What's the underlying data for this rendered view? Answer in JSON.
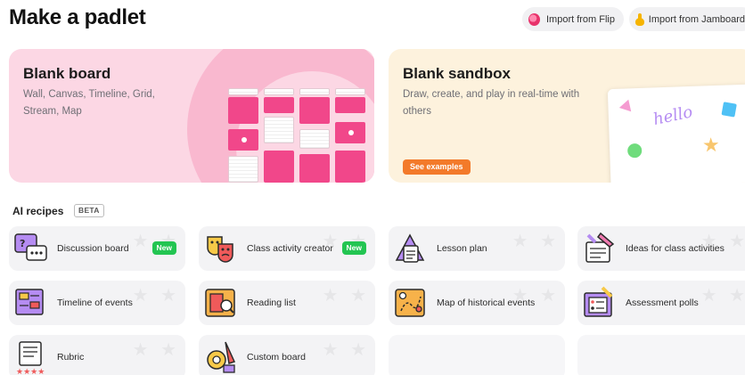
{
  "header": {
    "title": "Make a padlet",
    "import_flip": "Import from Flip",
    "import_jamboard": "Import from Jamboard"
  },
  "hero_board": {
    "title": "Blank board",
    "description": "Wall, Canvas, Timeline, Grid, Stream, Map"
  },
  "hero_sandbox": {
    "title": "Blank sandbox",
    "description": "Draw, create, and play in real-time with others",
    "button": "See examples",
    "doodle_text": "hello"
  },
  "ai_recipes": {
    "label": "AI recipes",
    "badge": "BETA",
    "new_badge": "New",
    "items": [
      {
        "label": "Discussion board",
        "icon": "discussion-icon",
        "is_new": true
      },
      {
        "label": "Class activity creator",
        "icon": "theater-masks-icon",
        "is_new": true
      },
      {
        "label": "Lesson plan",
        "icon": "lesson-plan-icon",
        "is_new": false
      },
      {
        "label": "Ideas for class activities",
        "icon": "ideas-icon",
        "is_new": false
      },
      {
        "label": "Timeline of events",
        "icon": "timeline-icon",
        "is_new": false
      },
      {
        "label": "Reading list",
        "icon": "reading-list-icon",
        "is_new": false
      },
      {
        "label": "Map of historical events",
        "icon": "map-icon",
        "is_new": false
      },
      {
        "label": "Assessment polls",
        "icon": "poll-icon",
        "is_new": false
      },
      {
        "label": "Rubric",
        "icon": "rubric-icon",
        "is_new": false
      },
      {
        "label": "Custom board",
        "icon": "custom-board-icon",
        "is_new": false
      }
    ]
  },
  "colors": {
    "board_bg": "#fcd7e4",
    "sandbox_bg": "#fdf2dd",
    "accent_pink": "#f1478a",
    "accent_orange": "#f37a2a",
    "new_green": "#23c552"
  }
}
